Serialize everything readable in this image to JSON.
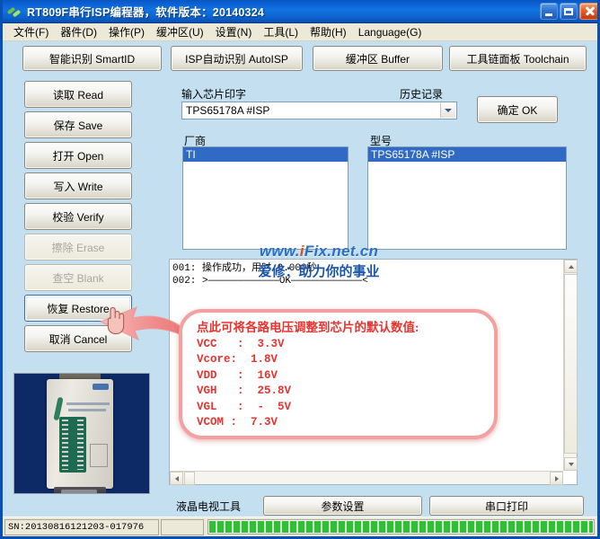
{
  "window": {
    "title": "RT809F串行ISP编程器，软件版本：20140324",
    "icon": "chip-clover-icon",
    "controls": {
      "minimize": "minimize-icon",
      "maximize": "maximize-icon",
      "close": "close-icon"
    }
  },
  "menu": [
    {
      "label": "文件(F)",
      "name": "menu-file"
    },
    {
      "label": "器件(D)",
      "name": "menu-device"
    },
    {
      "label": "操作(P)",
      "name": "menu-operation"
    },
    {
      "label": "缓冲区(U)",
      "name": "menu-buffer"
    },
    {
      "label": "设置(N)",
      "name": "menu-settings"
    },
    {
      "label": "工具(L)",
      "name": "menu-tools"
    },
    {
      "label": "帮助(H)",
      "name": "menu-help"
    },
    {
      "label": "Language(G)",
      "name": "menu-language"
    }
  ],
  "toolbar": [
    {
      "label": "智能识别 SmartID"
    },
    {
      "label": "ISP自动识别 AutoISP"
    },
    {
      "label": "缓冲区 Buffer"
    },
    {
      "label": "工具链面板 Toolchain"
    }
  ],
  "side_buttons": [
    {
      "label": "读取 Read",
      "state": "enabled"
    },
    {
      "label": "保存 Save",
      "state": "enabled"
    },
    {
      "label": "打开 Open",
      "state": "enabled"
    },
    {
      "label": "写入 Write",
      "state": "enabled"
    },
    {
      "label": "校验 Verify",
      "state": "enabled"
    },
    {
      "label": "擦除 Erase",
      "state": "disabled"
    },
    {
      "label": "查空 Blank",
      "state": "disabled"
    },
    {
      "label": "恢复 Restore",
      "state": "focused"
    },
    {
      "label": "取消 Cancel",
      "state": "enabled"
    }
  ],
  "device_panel": {
    "chip_input_label": "输入芯片印字",
    "history_label": "历史记录",
    "chip_input_value": "TPS65178A #ISP",
    "chip_input_placeholder": "输入芯片印字",
    "ok_button": "确定 OK",
    "vendor_label": "厂商",
    "model_label": "型号",
    "vendors": [
      "TI"
    ],
    "vendor_selected": "TI",
    "models": [
      "TPS65178A #ISP"
    ],
    "model_selected": "TPS65178A #ISP"
  },
  "log": {
    "lines": [
      "001: 操作成功，用时 0.000秒",
      "002: >————————————OK————————————<"
    ]
  },
  "watermark": {
    "line1_pre": "www.",
    "line1_em": "i",
    "line1_post": "Fix.net.cn",
    "line2": "爱修：助力你的事业"
  },
  "callout": {
    "header": "点此可将各路电压调整到芯片的默认数值:",
    "rows": [
      "VCC   :  3.3V",
      "Vcore:  1.8V",
      "VDD   :  16V",
      "VGH   :  25.8V",
      "VGL   :  -  5V",
      "VCOM :  7.3V"
    ],
    "border_color": "#f2a0a0",
    "text_color": "#e8332f",
    "arrow_color": "#f08080"
  },
  "bottom": {
    "tool_label": "液晶电视工具",
    "param_button": "参数设置",
    "serialprint_button": "串口打印"
  },
  "status": {
    "sn": "SN:20130816121203-017976",
    "progress_percent": 100,
    "progress_color": "#2fbf34"
  }
}
